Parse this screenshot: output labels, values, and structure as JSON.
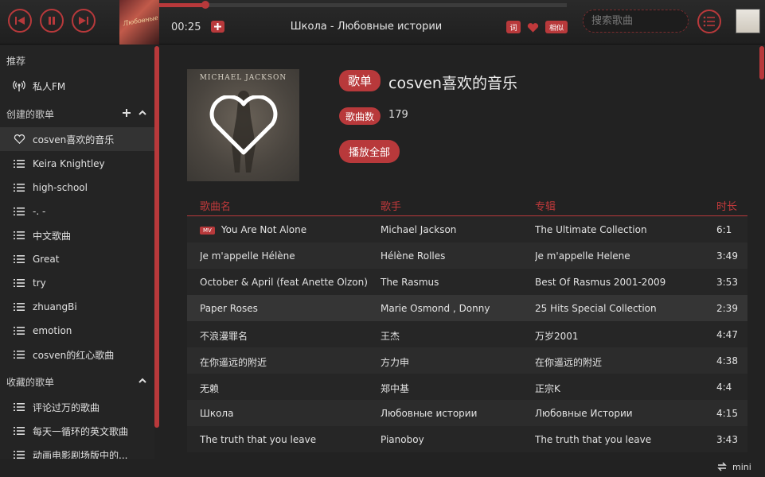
{
  "player": {
    "time": "00:25",
    "now_playing": "Школа - Любовные истории",
    "lyric_label": "词",
    "similar_label": "相似",
    "progress": 0.113,
    "cover_text": "Любовные истории"
  },
  "search": {
    "placeholder": "搜索歌曲"
  },
  "sidebar": {
    "recommend_title": "推荐",
    "fm_label": "私人FM",
    "created_title": "创建的歌单",
    "created": [
      {
        "label": "cosven喜欢的音乐",
        "icon": "heart-icon",
        "active": true
      },
      {
        "label": "Keira Knightley",
        "icon": "list-icon"
      },
      {
        "label": "high-school",
        "icon": "list-icon"
      },
      {
        "label": "-. -",
        "icon": "list-icon"
      },
      {
        "label": "中文歌曲",
        "icon": "list-icon"
      },
      {
        "label": "Great",
        "icon": "list-icon"
      },
      {
        "label": "try",
        "icon": "list-icon"
      },
      {
        "label": "zhuangBi",
        "icon": "list-icon"
      },
      {
        "label": "emotion",
        "icon": "list-icon"
      },
      {
        "label": "cosven的红心歌曲",
        "icon": "list-icon"
      }
    ],
    "collected_title": "收藏的歌单",
    "collected": [
      {
        "label": "评论过万的歌曲"
      },
      {
        "label": "每天一循环的英文歌曲"
      },
      {
        "label": "动画电影剧场版中的..."
      }
    ]
  },
  "playlist": {
    "type_label": "歌单",
    "title": "cosven喜欢的音乐",
    "count_label": "歌曲数",
    "count": "179",
    "play_all_label": "播放全部",
    "art_text": "MICHAEL JACKSON"
  },
  "table": {
    "headers": {
      "title": "歌曲名",
      "artist": "歌手",
      "album": "专辑",
      "duration": "时长"
    },
    "rows": [
      {
        "title": "You Are Not Alone",
        "mv": "MV",
        "artist": "Michael Jackson",
        "album": "The Ultimate Collection",
        "duration": "6:1"
      },
      {
        "title": "Je m'appelle Hélène",
        "artist": "Hélène Rolles",
        "album": "Je m'appelle Helene",
        "duration": "3:49"
      },
      {
        "title": "October & April (feat Anette Olzon)",
        "artist": "The Rasmus",
        "album": "Best Of Rasmus 2001-2009",
        "duration": "3:53"
      },
      {
        "title": "Paper Roses",
        "artist": "Marie Osmond , Donny",
        "album": "25 Hits Special Collection",
        "duration": "2:39",
        "highlight": true
      },
      {
        "title": "不浪漫罪名",
        "artist": "王杰",
        "album": "万岁2001",
        "duration": "4:47"
      },
      {
        "title": "在你遥远的附近",
        "artist": "方力申",
        "album": "在你遥远的附近",
        "duration": "4:38"
      },
      {
        "title": "无赖",
        "artist": "郑中基",
        "album": "正宗K",
        "duration": "4:4"
      },
      {
        "title": "Школа",
        "artist": "Любовные истории",
        "album": "Любовные Истории",
        "duration": "4:15"
      },
      {
        "title": "The truth that you leave",
        "artist": "Pianoboy",
        "album": "The truth that you leave",
        "duration": "3:43"
      }
    ]
  },
  "footer": {
    "mini_label": "mini"
  },
  "colors": {
    "accent": "#b8393b",
    "background": "#222222"
  }
}
